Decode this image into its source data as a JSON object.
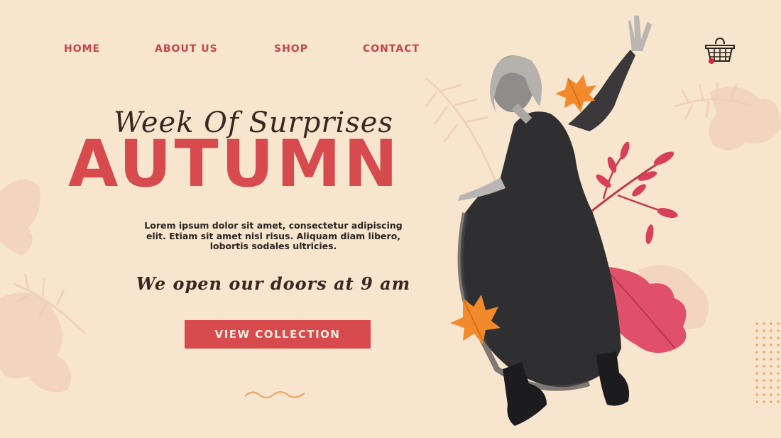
{
  "nav": {
    "home": "HOME",
    "about": "ABOUT US",
    "shop": "SHOP",
    "contact": "CONTACT"
  },
  "hero": {
    "script_title": "Week Of Surprises",
    "title": "AUTUMN",
    "description": "Lorem ipsum dolor sit amet, consectetur adipiscing elit. Etiam sit amet nisl risus. Aliquam diam libero, lobortis sodales ultricies.",
    "hours": "We open our doors at 9 am",
    "cta_label": "VIEW COLLECTION"
  },
  "icons": {
    "cart": "shopping-basket-icon",
    "cart_badge": "notification-dot"
  },
  "colors": {
    "background": "#f8e5cd",
    "accent": "#d74a4d",
    "dark_text": "#3a2622",
    "leaf_orange": "#f28a2c",
    "leaf_pink": "#e0506a"
  }
}
